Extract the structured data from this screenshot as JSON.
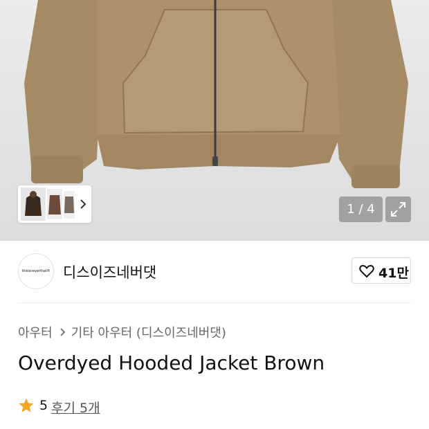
{
  "gallery": {
    "counter": "1 / 4"
  },
  "brand": {
    "logo_text": "thisisneverthat®",
    "name": "디스이즈네버댓"
  },
  "like": {
    "count": "41만"
  },
  "breadcrumb": {
    "category": "아우터",
    "subcategory": "기타 아우터 (디스이즈네버댓)"
  },
  "product": {
    "title": "Overdyed Hooded Jacket Brown"
  },
  "rating": {
    "score": "5",
    "reviews": "후기 5개"
  },
  "colors": {
    "jacket": "#a98d68",
    "star": "#f5a623",
    "overlay": "#8c8c8c"
  }
}
